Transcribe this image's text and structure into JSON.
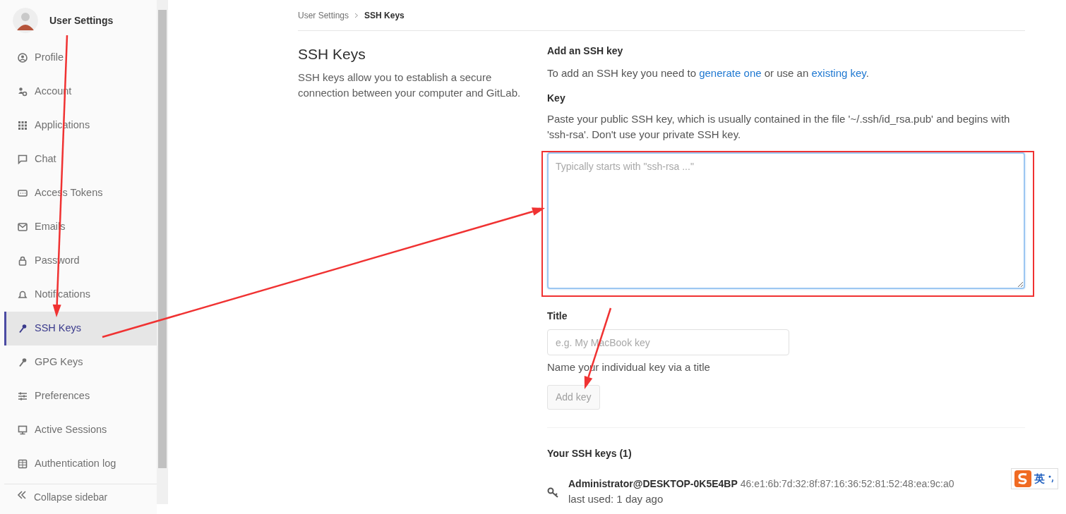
{
  "sidebar": {
    "title": "User Settings",
    "items": [
      {
        "label": "Profile",
        "kind": "profile",
        "selected": false
      },
      {
        "label": "Account",
        "kind": "account",
        "selected": false
      },
      {
        "label": "Applications",
        "kind": "apps",
        "selected": false
      },
      {
        "label": "Chat",
        "kind": "chat",
        "selected": false
      },
      {
        "label": "Access Tokens",
        "kind": "token",
        "selected": false
      },
      {
        "label": "Emails",
        "kind": "mail",
        "selected": false
      },
      {
        "label": "Password",
        "kind": "lock",
        "selected": false
      },
      {
        "label": "Notifications",
        "kind": "bell",
        "selected": false
      },
      {
        "label": "SSH Keys",
        "kind": "key",
        "selected": true
      },
      {
        "label": "GPG Keys",
        "kind": "key",
        "selected": false
      },
      {
        "label": "Preferences",
        "kind": "sliders",
        "selected": false
      },
      {
        "label": "Active Sessions",
        "kind": "monitor",
        "selected": false
      },
      {
        "label": "Authentication log",
        "kind": "log",
        "selected": false
      }
    ],
    "collapse_label": "Collapse sidebar"
  },
  "breadcrumb": [
    {
      "label": "User Settings",
      "selected": false
    },
    {
      "label": "SSH Keys",
      "selected": true
    }
  ],
  "intro": {
    "title": "SSH Keys",
    "text": "SSH keys allow you to establish a secure connection between your computer and GitLab."
  },
  "form": {
    "heading": "Add an SSH key",
    "help": [
      {
        "kind": "text",
        "text": "To add an SSH key you need to "
      },
      {
        "kind": "link",
        "text": "generate one"
      },
      {
        "kind": "text",
        "text": " or use an "
      },
      {
        "kind": "link",
        "text": "existing key"
      },
      {
        "kind": "text",
        "text": "."
      }
    ],
    "key_label": "Key",
    "key_help": "Paste your public SSH key, which is usually contained in the file '~/.ssh/id_rsa.pub' and begins with 'ssh-rsa'. Don't use your private SSH key.",
    "key_placeholder": "Typically starts with \"ssh-rsa ...\"",
    "title_label": "Title",
    "title_placeholder": "e.g. My MacBook key",
    "title_help": "Name your individual key via a title",
    "submit": {
      "label": "Add key",
      "disabled": true
    }
  },
  "keys": {
    "heading": "Your SSH keys (1)",
    "items": [
      {
        "name": "Administrator@DESKTOP-0K5E4BP",
        "fingerprint": "46:e1:6b:7d:32:8f:87:16:36:52:81:52:48:ea:9c:a0",
        "last_used": "last used: 1 day ago"
      }
    ]
  },
  "ime_toolbar": {
    "label": "英"
  },
  "annotations": [
    {
      "kind": "arrow"
    },
    {
      "kind": "arrow"
    },
    {
      "kind": "arrow"
    },
    {
      "kind": "box"
    }
  ]
}
